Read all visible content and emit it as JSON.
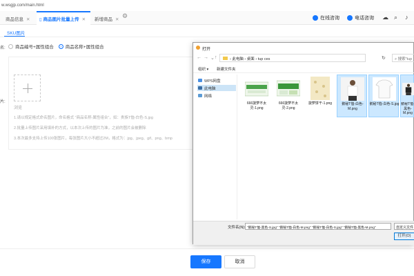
{
  "browser": {
    "address": "w.wsgjp.com/main.html"
  },
  "tabs": [
    {
      "label": "商品信息",
      "close": "✕"
    },
    {
      "label": "商品图片批量上传",
      "close": "✕"
    },
    {
      "label": "新增商品",
      "close": "✕"
    }
  ],
  "header": {
    "online": "在线咨询",
    "phone": "电话咨询"
  },
  "sku_tab": "SKU图片",
  "form": {
    "label_1": "名:",
    "radio_1": "商品编号+属性组合",
    "radio_2": "商品名称+属性组合",
    "label_2": "片:",
    "upload_label": "浏览",
    "notes": [
      "1.请以规定格式命名图片，命名格式 \"商品名称-属性组合\"，如：贵族T恤-白色-S.jpg",
      "2.批量上传图片采用填补的方式，以本次上传的图片为准，之前的图片会被删除",
      "3.本次最多支持上传100张图片，每张图片大小不超过2M，格式为：jpg、jpeg、gif、png、bmp"
    ]
  },
  "actions": {
    "save": "保存",
    "cancel": "取消"
  },
  "dialog": {
    "title": "打开",
    "path": [
      "此电脑",
      "桌面",
      "tup ces"
    ],
    "search_placeholder": "搜索\"tup",
    "organize": "组织 ▾",
    "new_folder": "新建文件夹",
    "tree": [
      "WPS网盘",
      "此电脑",
      "网络"
    ],
    "files": [
      {
        "name": "666菠萝不太灵-1.png",
        "selected": false
      },
      {
        "name": "666菠萝不太灵-2.png",
        "selected": false
      },
      {
        "name": "菠萝饼干-1.png",
        "selected": false
      },
      {
        "name": "鹅秘T恤-白色-M.png",
        "selected": true
      },
      {
        "name": "鹅秘T恤-白色-S.jpg",
        "selected": true
      },
      {
        "name": "鹅秘T恤-黑色-M.png",
        "selected": true
      }
    ],
    "filename_label": "文件名(N):",
    "filename_value": "\"鹅秘T恤-黑色-S.jpg\" \"鹅秘T恤-白色-M.png\" \"鹅秘T恤-白色-S.jpg\" \"鹅秘T恤-黑色-M.png\"",
    "filetype": "自定义文件 (*",
    "open": "打开(O)"
  }
}
